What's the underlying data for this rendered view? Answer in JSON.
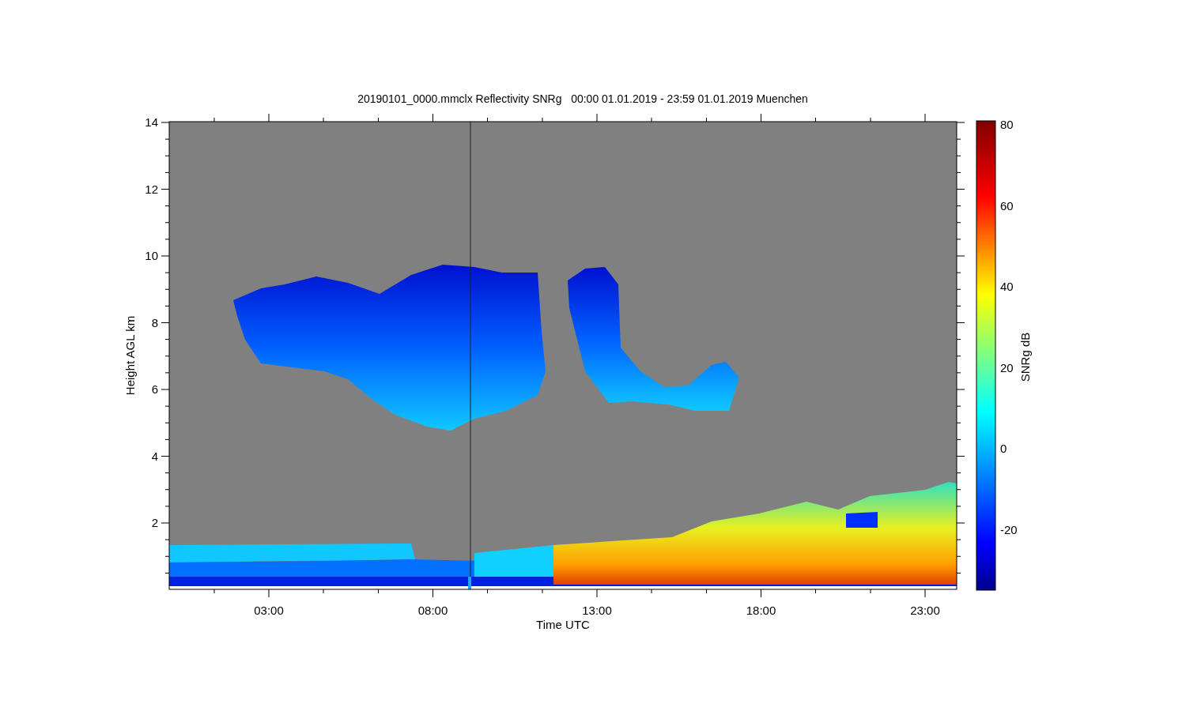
{
  "title": "20190101_0000.mmclx Reflectivity SNRg   00:00 01.01.2019 - 23:59 01.01.2019 Muenchen",
  "y_axis": {
    "label": "Height AGL km",
    "ticks": [
      "14",
      "12",
      "10",
      "8",
      "6",
      "4",
      "2"
    ]
  },
  "x_axis": {
    "label": "Time UTC",
    "ticks": [
      "03:00",
      "08:00",
      "13:00",
      "18:00",
      "23:00"
    ]
  },
  "colorbar": {
    "label": "SNRg dB",
    "ticks": [
      "80",
      "60",
      "40",
      "20",
      "0",
      "-20"
    ]
  }
}
